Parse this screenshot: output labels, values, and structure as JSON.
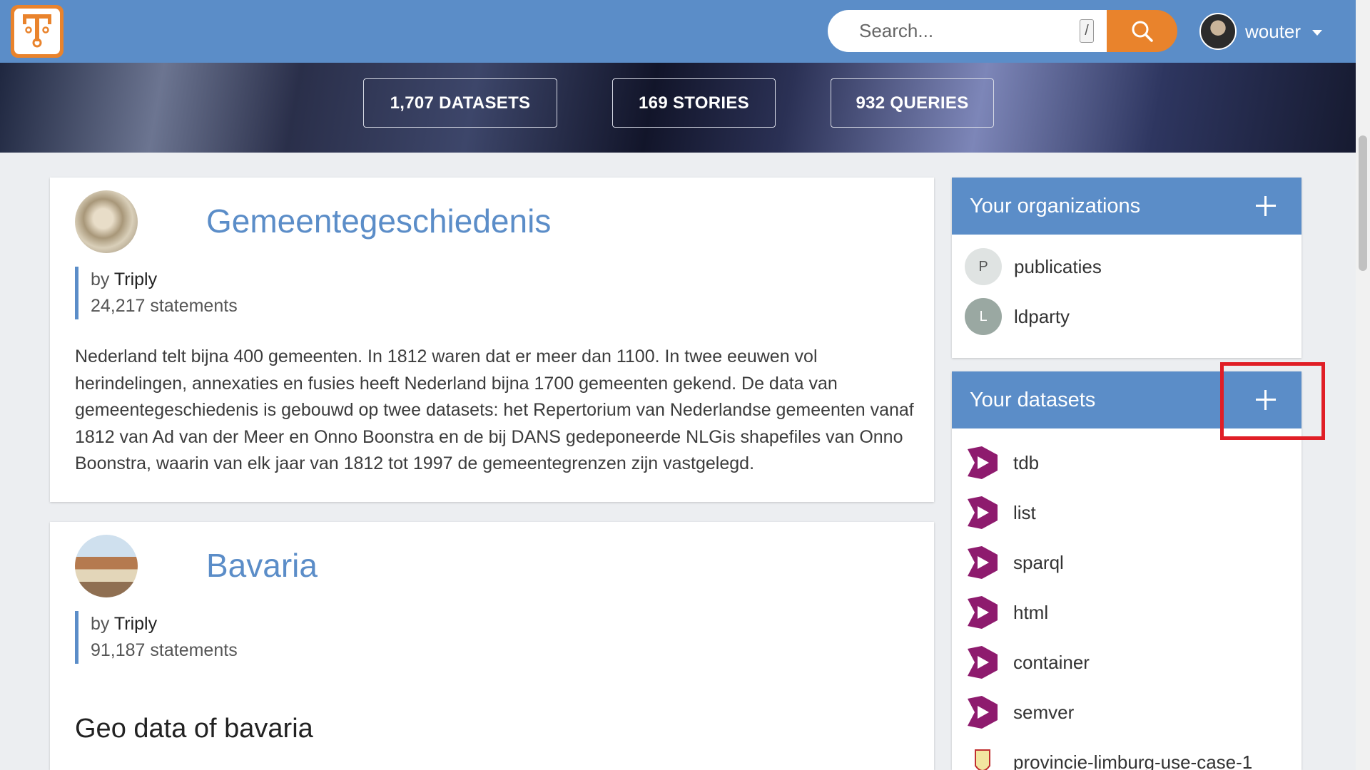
{
  "header": {
    "search_placeholder": "Search...",
    "slash_hint": "/",
    "username": "wouter"
  },
  "stats": [
    {
      "label": "1,707 DATASETS"
    },
    {
      "label": "169 STORIES"
    },
    {
      "label": "932 QUERIES"
    }
  ],
  "cards": [
    {
      "title": "Gemeentegeschiedenis",
      "by": "by",
      "owner": "Triply",
      "statements": "24,217 statements",
      "description": "Nederland telt bijna 400 gemeenten. In 1812 waren dat er meer dan 1100. In twee eeuwen vol herindelingen, annexaties en fusies heeft Nederland bijna 1700 gemeenten gekend. De data van gemeentegeschiedenis is gebouwd op twee datasets: het Repertorium van Nederlandse gemeenten vanaf 1812 van Ad van der Meer en Onno Boonstra en de bij DANS gedeponeerde NLGis shapefiles van Onno Boonstra, waarin van elk jaar van 1812 tot 1997 de gemeentegrenzen zijn vastgelegd."
    },
    {
      "title": "Bavaria",
      "by": "by",
      "owner": "Triply",
      "statements": "91,187 statements",
      "description": "Geo data of bavaria"
    }
  ],
  "organizations": {
    "title": "Your organizations",
    "items": [
      {
        "initial": "P",
        "name": "publicaties",
        "color": "#dfe3e2"
      },
      {
        "initial": "L",
        "name": "ldparty",
        "color": "#9aa8a2"
      }
    ]
  },
  "datasets": {
    "title": "Your datasets",
    "items": [
      {
        "name": "tdb"
      },
      {
        "name": "list"
      },
      {
        "name": "sparql"
      },
      {
        "name": "html"
      },
      {
        "name": "container"
      },
      {
        "name": "semver"
      },
      {
        "name": "provincie-limburg-use-case-1"
      }
    ],
    "icon_color": "#8e1b6e"
  },
  "colors": {
    "primary": "#5b8dc8",
    "accent": "#e9832c",
    "highlight": "#e01e26"
  }
}
